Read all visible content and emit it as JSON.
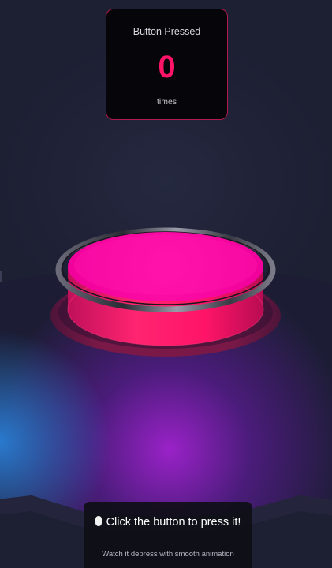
{
  "counter": {
    "title": "Button Pressed",
    "value": "0",
    "unit": "times"
  },
  "instructions": {
    "icon": "mouse-icon",
    "main": "Click the button to press it!",
    "sub": "Watch it depress with smooth animation"
  },
  "colors": {
    "accent": "#ff1466",
    "button_top": "#ff0aa0",
    "button_side": "#ff1670",
    "panel_border": "#b01a4c",
    "background": "#1d1f33",
    "platform_glow": "#9a22c8",
    "platform_edge_glow": "#2a7fd6"
  }
}
